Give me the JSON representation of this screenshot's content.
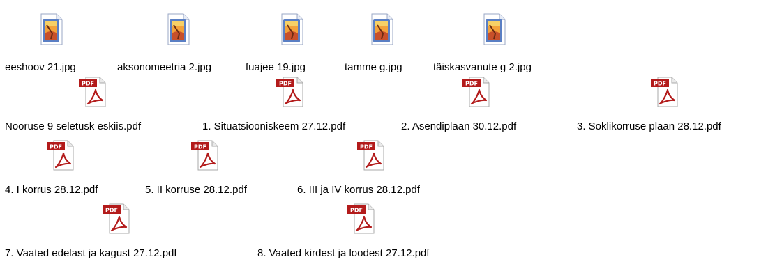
{
  "folder": {
    "rows": [
      {
        "items": [
          {
            "type": "jpg",
            "icon": "image-file-icon",
            "label": "eeshoov 21.jpg"
          },
          {
            "type": "jpg",
            "icon": "image-file-icon",
            "label": "aksonomeetria 2.jpg"
          },
          {
            "type": "jpg",
            "icon": "image-file-icon",
            "label": "fuajee 19.jpg"
          },
          {
            "type": "jpg",
            "icon": "image-file-icon",
            "label": "tamme g.jpg"
          },
          {
            "type": "jpg",
            "icon": "image-file-icon",
            "label": "täiskasvanute g 2.jpg"
          }
        ]
      },
      {
        "items": [
          {
            "type": "pdf",
            "icon": "pdf-file-icon",
            "label": "Nooruse 9 seletusk eskiis.pdf"
          },
          {
            "type": "pdf",
            "icon": "pdf-file-icon",
            "label": "1. Situatsiooniskeem 27.12.pdf"
          },
          {
            "type": "pdf",
            "icon": "pdf-file-icon",
            "label": "2. Asendiplaan 30.12.pdf"
          },
          {
            "type": "pdf",
            "icon": "pdf-file-icon",
            "label": "3. Soklikorruse plaan 28.12.pdf"
          }
        ]
      },
      {
        "items": [
          {
            "type": "pdf",
            "icon": "pdf-file-icon",
            "label": "4. I korrus 28.12.pdf"
          },
          {
            "type": "pdf",
            "icon": "pdf-file-icon",
            "label": "5. II korruse 28.12.pdf"
          },
          {
            "type": "pdf",
            "icon": "pdf-file-icon",
            "label": "6. III ja IV korrus 28.12.pdf"
          }
        ]
      },
      {
        "items": [
          {
            "type": "pdf",
            "icon": "pdf-file-icon",
            "label": "7. Vaated edelast ja kagust 27.12.pdf"
          },
          {
            "type": "pdf",
            "icon": "pdf-file-icon",
            "label": "8. Vaated kirdest ja loodest 27.12.pdf"
          }
        ]
      }
    ],
    "pdf_badge_text": "PDF",
    "colors": {
      "pdf_red": "#b31b1b",
      "image_frame": "#5a7fc4"
    }
  }
}
